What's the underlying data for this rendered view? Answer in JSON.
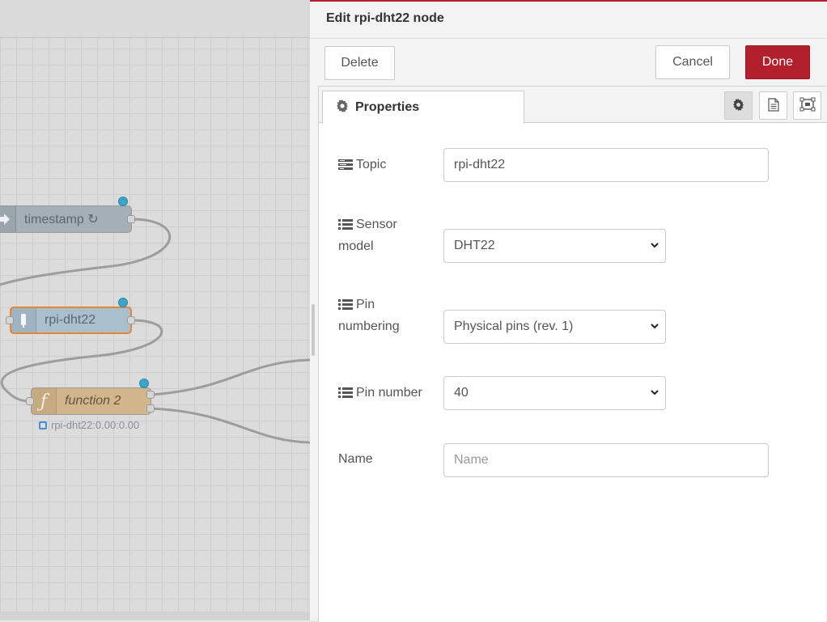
{
  "workspace": {
    "nodes": {
      "inject": {
        "label": "timestamp ↻",
        "icon": "arrow-icon"
      },
      "dht": {
        "label": "rpi-dht22",
        "icon": "sensor-icon"
      },
      "function": {
        "label": "function 2",
        "icon": "function-icon",
        "icon_glyph": "ƒ"
      }
    },
    "status_text": "rpi-dht22:0.00:0.00"
  },
  "editor": {
    "title": "Edit rpi-dht22 node",
    "buttons": {
      "delete": "Delete",
      "cancel": "Cancel",
      "done": "Done"
    },
    "tabs": {
      "properties": "Properties"
    },
    "form": {
      "topic": {
        "label": "Topic",
        "value": "rpi-dht22"
      },
      "sensor_model": {
        "label_line1": "Sensor",
        "label_line2": "model",
        "value": "DHT22"
      },
      "pin_numbering": {
        "label_line1": "Pin",
        "label_line2": "numbering",
        "value": "Physical pins (rev. 1)"
      },
      "pin_number": {
        "label": "Pin number",
        "value": "40"
      },
      "name": {
        "label": "Name",
        "placeholder": "Name",
        "value": ""
      }
    }
  },
  "colors": {
    "accent": "#b21f2d",
    "inject_node": "#a4afb8",
    "dht_node": "#a9bfcc",
    "function_node": "#d3b58b",
    "selection": "#e5843b",
    "changed_dot": "#3ea5c8"
  }
}
